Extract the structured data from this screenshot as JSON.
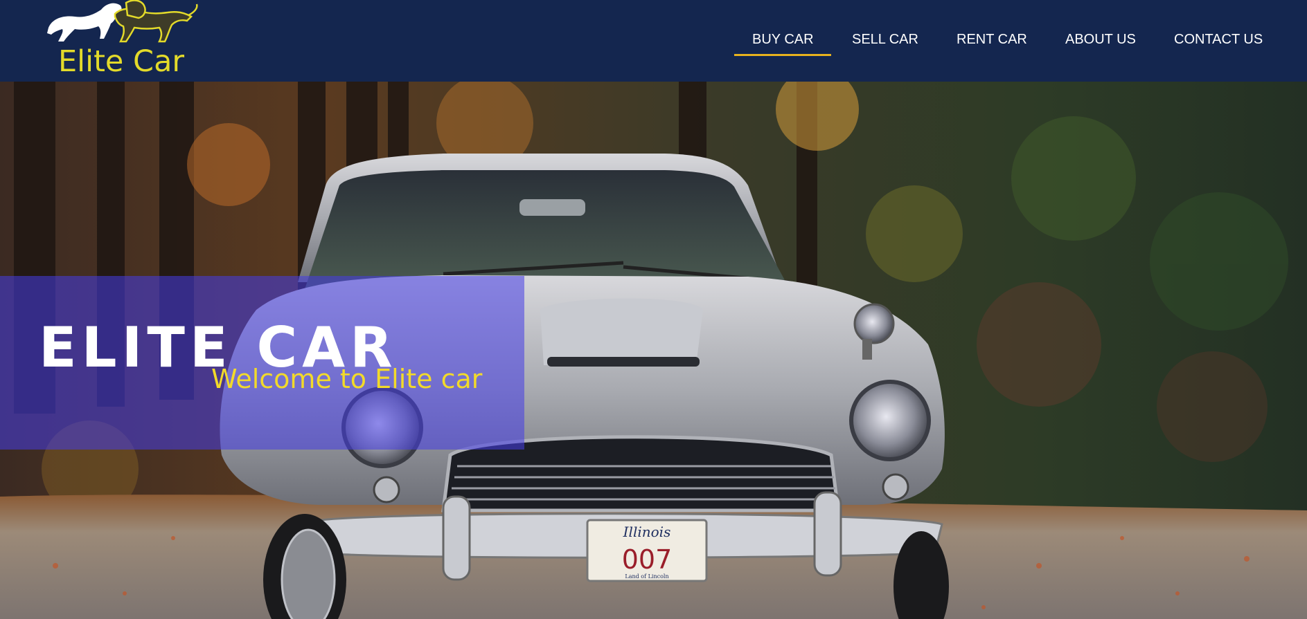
{
  "header": {
    "logo": {
      "icon": "lion-icon",
      "text": "Elite Car",
      "colors": {
        "primary": "#e3da2a",
        "secondary": "#ffffff"
      }
    },
    "nav": [
      {
        "label": "BUY CAR",
        "active": true
      },
      {
        "label": "SELL CAR",
        "active": false
      },
      {
        "label": "RENT CAR",
        "active": false
      },
      {
        "label": "ABOUT US",
        "active": false
      },
      {
        "label": "CONTACT US",
        "active": false
      }
    ],
    "colors": {
      "background": "#14264f",
      "active_underline": "#e8b21e",
      "nav_text": "#ffffff"
    }
  },
  "hero": {
    "title": "ELITE CAR",
    "subtitle": "Welcome to Elite car",
    "background_image": "silver-classic-car-in-autumn-forest",
    "license_plate": {
      "state": "Illinois",
      "number": "007",
      "tagline": "Land of Lincoln"
    },
    "colors": {
      "panel": "#463ce6",
      "title": "#ffffff",
      "subtitle": "#f2da2a"
    }
  }
}
